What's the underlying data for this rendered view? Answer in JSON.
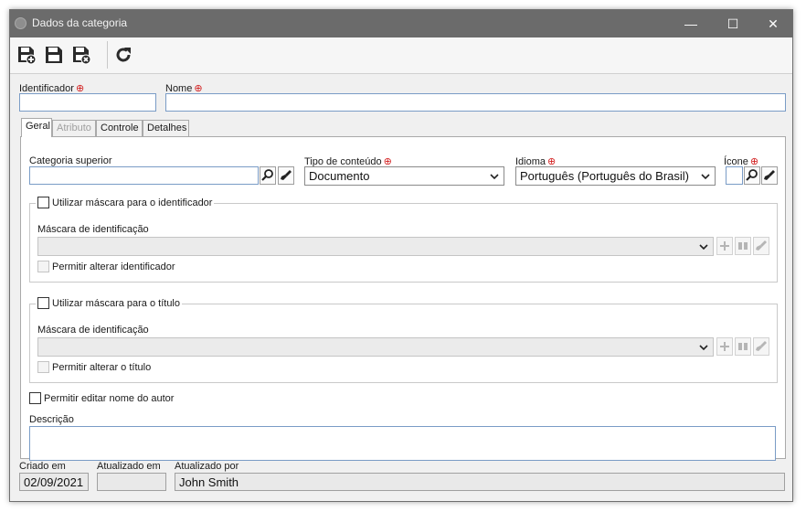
{
  "window": {
    "title": "Dados da categoria",
    "controls": {
      "minimize": "—",
      "maximize": "☐",
      "close": "✕"
    }
  },
  "toolbar": {
    "buttons": [
      {
        "icon": "save-new-icon"
      },
      {
        "icon": "save-icon"
      },
      {
        "icon": "save-close-icon"
      },
      {
        "icon": "refresh-icon"
      }
    ]
  },
  "header": {
    "identificador_label": "Identificador",
    "identificador_value": "",
    "nome_label": "Nome",
    "nome_value": ""
  },
  "tabs": [
    {
      "label": "Geral",
      "state": "active"
    },
    {
      "label": "Atributo",
      "state": "disabled"
    },
    {
      "label": "Controle",
      "state": "normal"
    },
    {
      "label": "Detalhes",
      "state": "normal"
    }
  ],
  "geral": {
    "categoria_superior_label": "Categoria superior",
    "categoria_superior_value": "",
    "tipo_conteudo_label": "Tipo de conteúdo",
    "tipo_conteudo_value": "Documento",
    "idioma_label": "Idioma",
    "idioma_value": "Português (Português do Brasil)",
    "icone_label": "Ícone",
    "mask_id_group": {
      "legend": "Utilizar máscara para o identificador",
      "field_label": "Máscara de identificação",
      "field_value": "",
      "allow_label": "Permitir alterar identificador"
    },
    "mask_title_group": {
      "legend": "Utilizar máscara para o título",
      "field_label": "Máscara de identificação",
      "field_value": "",
      "allow_label": "Permitir alterar o título"
    },
    "editar_autor_label": "Permitir editar nome do autor",
    "descricao_label": "Descrição",
    "descricao_value": ""
  },
  "footer": {
    "criado_em_label": "Criado em",
    "criado_em_value": "02/09/2021",
    "atualizado_em_label": "Atualizado em",
    "atualizado_em_value": "",
    "atualizado_por_label": "Atualizado por",
    "atualizado_por_value": "John Smith"
  },
  "colors": {
    "titlebar": "#6b6b6b",
    "required_marker": "#d21e1e",
    "input_border": "#7a9cc6"
  }
}
